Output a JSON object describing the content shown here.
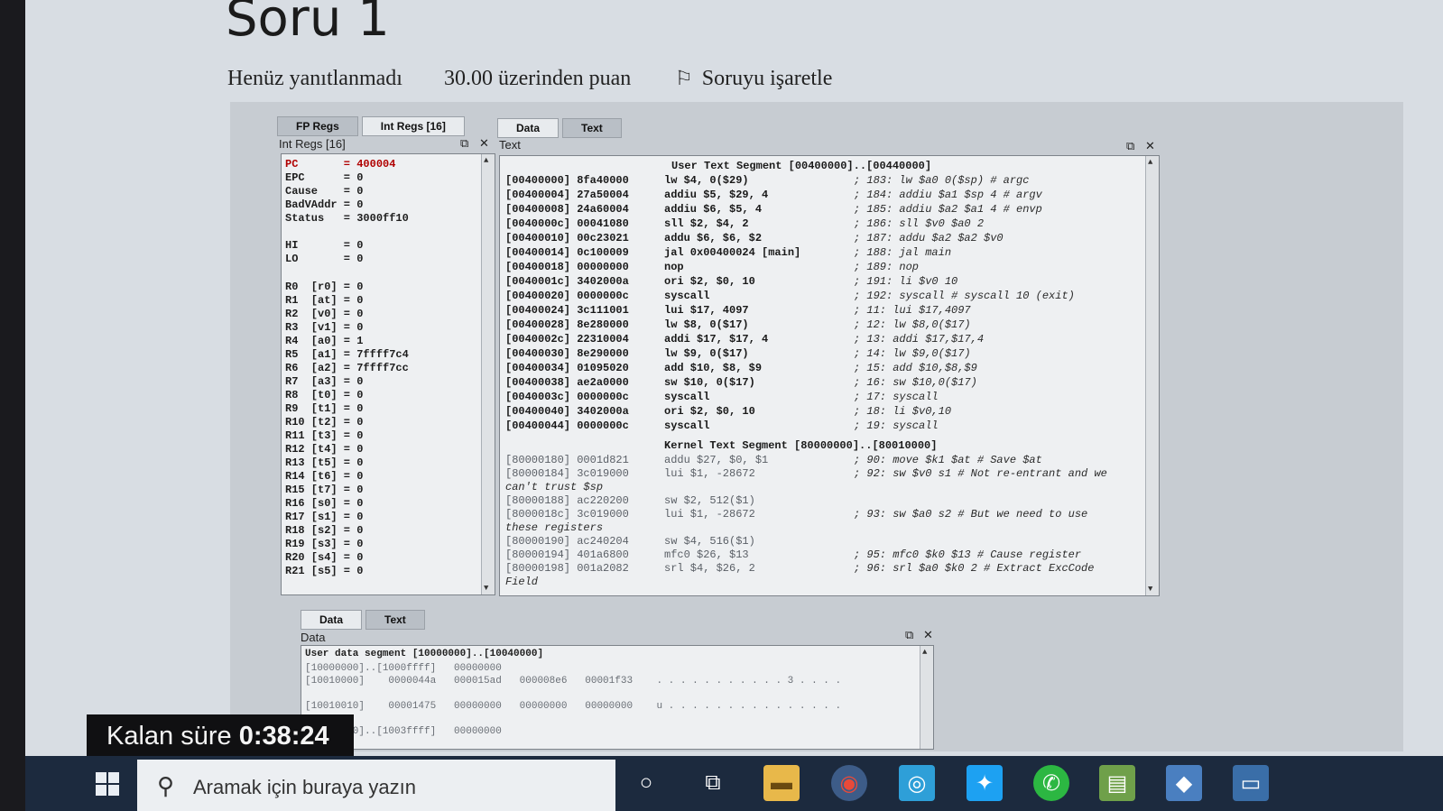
{
  "question": {
    "title": "Soru 1",
    "status": "Henüz yanıtlanmadı",
    "points": "30.00 üzerinden puan",
    "flag_label": "Soruyu işaretle"
  },
  "registers_panel": {
    "tabs": [
      "FP Regs",
      "Int Regs [16]"
    ],
    "caption": "Int Regs [16]",
    "rows": [
      "PC       = 400004",
      "EPC      = 0",
      "Cause    = 0",
      "BadVAddr = 0",
      "Status   = 3000ff10",
      "",
      "HI       = 0",
      "LO       = 0",
      "",
      "R0  [r0] = 0",
      "R1  [at] = 0",
      "R2  [v0] = 0",
      "R3  [v1] = 0",
      "R4  [a0] = 1",
      "R5  [a1] = 7ffff7c4",
      "R6  [a2] = 7ffff7cc",
      "R7  [a3] = 0",
      "R8  [t0] = 0",
      "R9  [t1] = 0",
      "R10 [t2] = 0",
      "R11 [t3] = 0",
      "R12 [t4] = 0",
      "R13 [t5] = 0",
      "R14 [t6] = 0",
      "R15 [t7] = 0",
      "R16 [s0] = 0",
      "R17 [s1] = 0",
      "R18 [s2] = 0",
      "R19 [s3] = 0",
      "R20 [s4] = 0",
      "R21 [s5] = 0"
    ]
  },
  "text_panel": {
    "tabs": [
      "Data",
      "Text"
    ],
    "caption": "Text",
    "user_segment_title": "User Text Segment [00400000]..[00440000]",
    "user_rows": [
      [
        "[00400000] 8fa40000",
        "lw $4, 0($29)",
        "; 183: lw $a0 0($sp) # argc"
      ],
      [
        "[00400004] 27a50004",
        "addiu $5, $29, 4",
        "; 184: addiu $a1 $sp 4 # argv"
      ],
      [
        "[00400008] 24a60004",
        "addiu $6, $5, 4",
        "; 185: addiu $a2 $a1 4 # envp"
      ],
      [
        "[0040000c] 00041080",
        "sll $2, $4, 2",
        "; 186: sll $v0 $a0 2"
      ],
      [
        "[00400010] 00c23021",
        "addu $6, $6, $2",
        "; 187: addu $a2 $a2 $v0"
      ],
      [
        "[00400014] 0c100009",
        "jal 0x00400024 [main]",
        "; 188: jal main"
      ],
      [
        "[00400018] 00000000",
        "nop",
        "; 189: nop"
      ],
      [
        "[0040001c] 3402000a",
        "ori $2, $0, 10",
        "; 191: li $v0 10"
      ],
      [
        "[00400020] 0000000c",
        "syscall",
        "; 192: syscall # syscall 10 (exit)"
      ],
      [
        "[00400024] 3c111001",
        "lui $17, 4097",
        "; 11: lui $17,4097"
      ],
      [
        "[00400028] 8e280000",
        "lw $8, 0($17)",
        "; 12: lw $8,0($17)"
      ],
      [
        "[0040002c] 22310004",
        "addi $17, $17, 4",
        "; 13: addi $17,$17,4"
      ],
      [
        "[00400030] 8e290000",
        "lw $9, 0($17)",
        "; 14: lw $9,0($17)"
      ],
      [
        "[00400034] 01095020",
        "add $10, $8, $9",
        "; 15: add $10,$8,$9"
      ],
      [
        "[00400038] ae2a0000",
        "sw $10, 0($17)",
        "; 16: sw $10,0($17)"
      ],
      [
        "[0040003c] 0000000c",
        "syscall",
        "; 17: syscall"
      ],
      [
        "[00400040] 3402000a",
        "ori $2, $0, 10",
        "; 18: li $v0,10"
      ],
      [
        "[00400044] 0000000c",
        "syscall",
        "; 19: syscall"
      ]
    ],
    "kernel_segment_title": "Kernel Text Segment [80000000]..[80010000]",
    "kernel_rows": [
      [
        "[80000180] 0001d821",
        "addu $27, $0, $1",
        "; 90: move $k1 $at # Save $at"
      ],
      [
        "[80000184] 3c019000",
        "lui $1, -28672",
        "; 92: sw $v0 s1 # Not re-entrant and we"
      ],
      [
        "can't trust $sp",
        "",
        ""
      ],
      [
        "[80000188] ac220200",
        "sw $2, 512($1)",
        ""
      ],
      [
        "[8000018c] 3c019000",
        "lui $1, -28672",
        "; 93: sw $a0 s2 # But we need to use"
      ],
      [
        "these registers",
        "",
        ""
      ],
      [
        "[80000190] ac240204",
        "sw $4, 516($1)",
        ""
      ],
      [
        "[80000194] 401a6800",
        "mfc0 $26, $13",
        "; 95: mfc0 $k0 $13 # Cause register"
      ],
      [
        "[80000198] 001a2082",
        "srl $4, $26, 2",
        "; 96: srl $a0 $k0 2 # Extract ExcCode"
      ],
      [
        "Field",
        "",
        ""
      ]
    ]
  },
  "data_panel": {
    "tabs": [
      "Data",
      "Text"
    ],
    "caption": "Data",
    "header": "User data segment [10000000]..[10040000]",
    "rows": [
      "[10000000]..[1000ffff]   00000000",
      "[10010000]    0000044a   000015ad   000008e6   00001f33    . . . . . . . . . . . 3 . . . .",
      "",
      "[10010010]    00001475   00000000   00000000   00000000    u . . . . . . . . . . . . . . .",
      "",
      "[10010020]..[1003ffff]   00000000"
    ]
  },
  "timer": {
    "label": "Kalan süre",
    "value": "0:38:24"
  },
  "taskbar": {
    "search_placeholder": "Aramak için buraya yazın",
    "icons": [
      "cortana-icon",
      "task-view-icon",
      "file-explorer-icon",
      "chrome-icon",
      "app-icon",
      "twitter-icon",
      "whatsapp-icon",
      "notepad-icon",
      "package-icon",
      "window-icon"
    ]
  }
}
